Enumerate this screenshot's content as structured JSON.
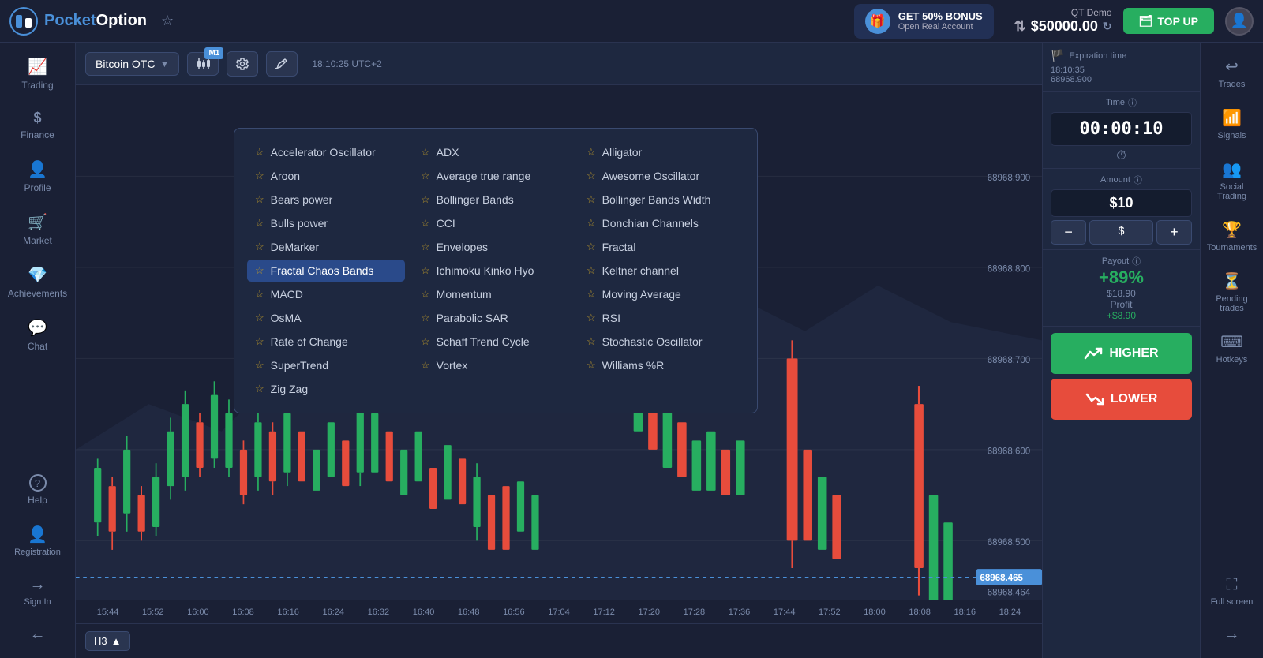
{
  "header": {
    "logo_pocket": "Pocket",
    "logo_option": "Option",
    "bonus_title": "GET 50% BONUS",
    "bonus_sub": "Open Real Account",
    "account_type": "QT Demo",
    "balance": "$50000.00",
    "topup_label": "TOP UP"
  },
  "toolbar": {
    "asset": "Bitcoin OTC",
    "timeframe_badge": "M1",
    "time_display": "18:10:25 UTC+2"
  },
  "indicators": {
    "col1": [
      {
        "label": "Accelerator Oscillator",
        "active": false
      },
      {
        "label": "Aroon",
        "active": false
      },
      {
        "label": "Bears power",
        "active": false
      },
      {
        "label": "Bulls power",
        "active": false
      },
      {
        "label": "DeMarker",
        "active": false
      },
      {
        "label": "Fractal Chaos Bands",
        "active": true
      },
      {
        "label": "MACD",
        "active": false
      },
      {
        "label": "OsMA",
        "active": false
      },
      {
        "label": "Rate of Change",
        "active": false
      },
      {
        "label": "SuperTrend",
        "active": false
      },
      {
        "label": "Zig Zag",
        "active": false
      }
    ],
    "col2": [
      {
        "label": "ADX",
        "active": false
      },
      {
        "label": "Average true range",
        "active": false
      },
      {
        "label": "Bollinger Bands",
        "active": false
      },
      {
        "label": "CCI",
        "active": false
      },
      {
        "label": "Envelopes",
        "active": false
      },
      {
        "label": "Ichimoku Kinko Hyo",
        "active": false
      },
      {
        "label": "Momentum",
        "active": false
      },
      {
        "label": "Parabolic SAR",
        "active": false
      },
      {
        "label": "Schaff Trend Cycle",
        "active": false
      },
      {
        "label": "Vortex",
        "active": false
      }
    ],
    "col3": [
      {
        "label": "Alligator",
        "active": false
      },
      {
        "label": "Awesome Oscillator",
        "active": false
      },
      {
        "label": "Bollinger Bands Width",
        "active": false
      },
      {
        "label": "Donchian Channels",
        "active": false
      },
      {
        "label": "Fractal",
        "active": false
      },
      {
        "label": "Keltner channel",
        "active": false
      },
      {
        "label": "Moving Average",
        "active": false
      },
      {
        "label": "RSI",
        "active": false
      },
      {
        "label": "Stochastic Oscillator",
        "active": false
      },
      {
        "label": "Williams %R",
        "active": false
      }
    ]
  },
  "price_levels": [
    "68968.900",
    "68968.800",
    "68968.700",
    "68968.600",
    "68968.500",
    "68968.464"
  ],
  "current_price": "68968.465",
  "time_labels": [
    "15:44",
    "15:52",
    "16:00",
    "16:08",
    "16:16",
    "16:24",
    "16:32",
    "16:40",
    "16:48",
    "16:56",
    "17:04",
    "17:12",
    "17:20",
    "17:28",
    "17:36",
    "17:44",
    "17:52",
    "18:00",
    "18:08",
    "18:16",
    "18:24"
  ],
  "right_panel": {
    "expiration_label": "Expiration time",
    "expiration_time": "18:10:35",
    "expiration_price": "68968.900",
    "time_label": "Time",
    "timer": "00:00:10",
    "amount_label": "Amount",
    "amount": "$10",
    "currency": "$",
    "payout_label": "Payout",
    "payout_pct": "+89%",
    "profit_label": "Profit",
    "profit_amount": "$18.90",
    "profit_val": "+$8.90",
    "higher_label": "HIGHER",
    "lower_label": "LOWER"
  },
  "right_sidebar": {
    "items": [
      {
        "icon": "↩",
        "label": "Trades"
      },
      {
        "icon": "📶",
        "label": "Signals"
      },
      {
        "icon": "👥",
        "label": "Social Trading"
      },
      {
        "icon": "🏆",
        "label": "Tournaments"
      },
      {
        "icon": "⏳",
        "label": "Pending trades"
      },
      {
        "icon": "⌨",
        "label": "Hotkeys"
      },
      {
        "icon": "⛶",
        "label": "Full screen"
      },
      {
        "icon": "→",
        "label": ""
      }
    ]
  },
  "left_sidebar": {
    "items": [
      {
        "icon": "📈",
        "label": "Trading"
      },
      {
        "icon": "$",
        "label": "Finance"
      },
      {
        "icon": "👤",
        "label": "Profile"
      },
      {
        "icon": "🛒",
        "label": "Market"
      },
      {
        "icon": "💎",
        "label": "Achievements"
      },
      {
        "icon": "💬",
        "label": "Chat"
      },
      {
        "icon": "?",
        "label": "Help"
      }
    ]
  },
  "bottom": {
    "timeframe": "H3"
  }
}
